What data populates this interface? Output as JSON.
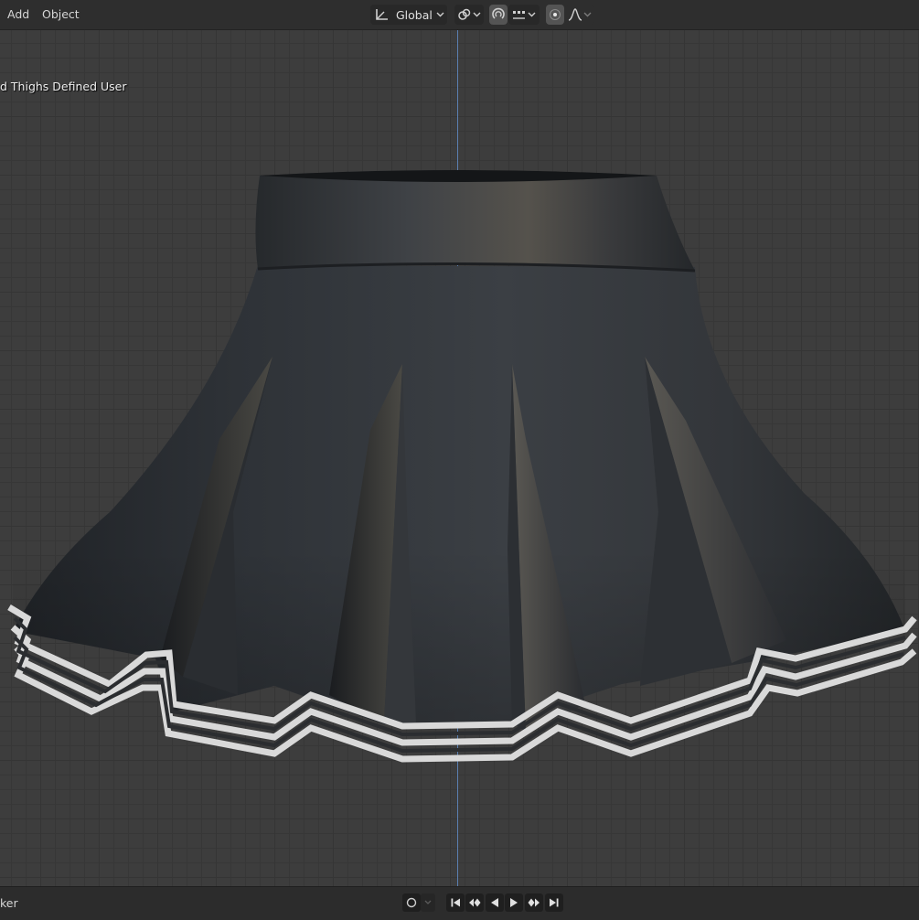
{
  "header": {
    "menu": [
      "Add",
      "Object"
    ],
    "transform_orientation": "Global",
    "pivot_icon": "pivot-icon",
    "snap_icon": "snap-icon",
    "proportional_icon": "proportional-editing-icon",
    "falloff_icon": "falloff-curve-icon"
  },
  "viewport": {
    "overlay_text": "d Thighs Defined User",
    "object": "pleated-skirt-model",
    "accent_axis_color": "#5a7fb1"
  },
  "timeline": {
    "label": "ker",
    "controls": [
      "record-icon",
      "jump-start-icon",
      "prev-keyframe-icon",
      "play-reverse-icon",
      "play-icon",
      "next-keyframe-icon",
      "jump-end-icon"
    ]
  }
}
